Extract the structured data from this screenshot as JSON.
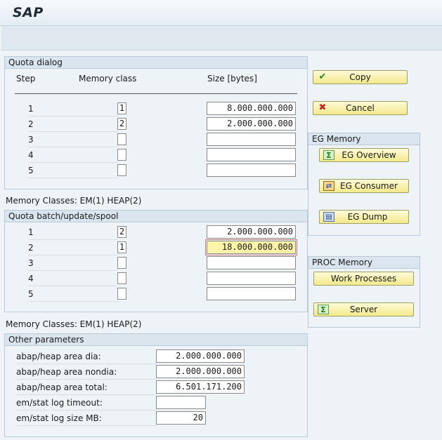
{
  "app": {
    "title": "SAP"
  },
  "quota_dialog": {
    "title": "Quota dialog",
    "headers": {
      "step": "Step",
      "memory_class": "Memory class",
      "size": "Size [bytes]"
    },
    "rows": [
      {
        "step": "1",
        "class": "1",
        "size": "8.000.000.000"
      },
      {
        "step": "2",
        "class": "2",
        "size": "2.000.000.000"
      },
      {
        "step": "3",
        "class": "",
        "size": ""
      },
      {
        "step": "4",
        "class": "",
        "size": ""
      },
      {
        "step": "5",
        "class": "",
        "size": ""
      }
    ]
  },
  "memory_classes_1": "Memory Classes:  EM(1) HEAP(2)",
  "quota_batch": {
    "title": "Quota batch/update/spool",
    "rows": [
      {
        "step": "1",
        "class": "2",
        "size": "2.000.000.000"
      },
      {
        "step": "2",
        "class": "1",
        "size": "18.000.000.000"
      },
      {
        "step": "3",
        "class": "",
        "size": ""
      },
      {
        "step": "4",
        "class": "",
        "size": ""
      },
      {
        "step": "5",
        "class": "",
        "size": ""
      }
    ]
  },
  "memory_classes_2": "Memory Classes:  EM(1) HEAP(2)",
  "other_params": {
    "title": "Other parameters",
    "rows": [
      {
        "label": "abap/heap area dia:",
        "value": "2.000.000.000"
      },
      {
        "label": "abap/heap area nondia:",
        "value": "2.000.000.000"
      },
      {
        "label": "abap/heap area total:",
        "value": "6.501.171.200"
      },
      {
        "label": "em/stat log timeout:",
        "value": ""
      },
      {
        "label": "em/stat log size MB:",
        "value": "20"
      }
    ]
  },
  "buttons": {
    "copy": "Copy",
    "cancel": "Cancel"
  },
  "eg_memory": {
    "title": "EG Memory",
    "overview": "EG Overview",
    "consumer": "EG Consumer",
    "dump": "EG Dump"
  },
  "proc_memory": {
    "title": "PROC Memory",
    "work_processes": "Work Processes",
    "server": "Server"
  },
  "icons": {
    "check": "✔",
    "cross": "✖",
    "sigma": "Σ",
    "consumer": "⇄",
    "dump": "▤"
  }
}
